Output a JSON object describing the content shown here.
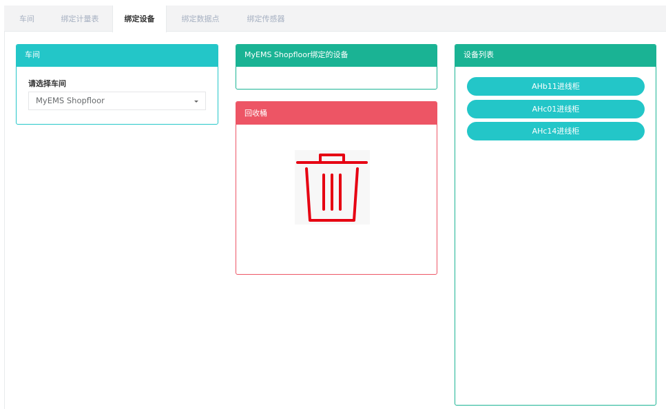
{
  "tabs": [
    {
      "label": "车间"
    },
    {
      "label": "绑定计量表"
    },
    {
      "label": "绑定设备"
    },
    {
      "label": "绑定数据点"
    },
    {
      "label": "绑定传感器"
    }
  ],
  "shopfloor_panel": {
    "title": "车间",
    "select_label": "请选择车间",
    "selected": "MyEMS Shopfloor"
  },
  "bound_panel": {
    "title": "MyEMS Shopfloor绑定的设备"
  },
  "trash_panel": {
    "title": "回收桶",
    "icon": "trash-icon"
  },
  "device_panel": {
    "title": "设备列表",
    "devices": [
      "AHb11进线柜",
      "AHc01进线柜",
      "AHc14进线柜"
    ]
  },
  "colors": {
    "info": "#23c6c8",
    "primary": "#1ab394",
    "danger": "#ed5565",
    "trash": "#e60012"
  }
}
